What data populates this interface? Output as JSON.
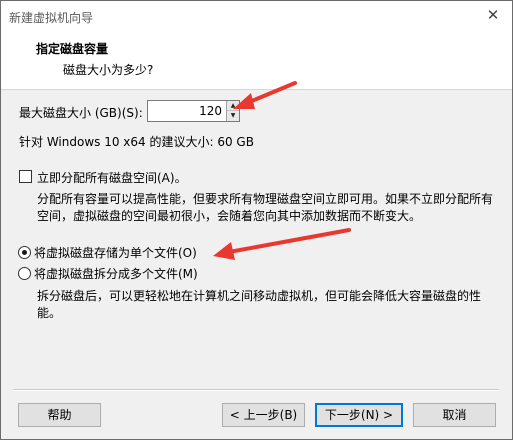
{
  "window": {
    "title": "新建虚拟机向导",
    "close_glyph": "✕"
  },
  "header": {
    "title": "指定磁盘容量",
    "subtitle": "磁盘大小为多少?"
  },
  "disk_size": {
    "label": "最大磁盘大小 (GB)(S):",
    "value": "120",
    "recommended": "针对 Windows 10 x64 的建议大小: 60 GB"
  },
  "allocate": {
    "label": "立即分配所有磁盘空间(A)。",
    "checked": false,
    "description": "分配所有容量可以提高性能，但要求所有物理磁盘空间立即可用。如果不立即分配所有空间，虚拟磁盘的空间最初很小，会随着您向其中添加数据而不断变大。"
  },
  "storage_options": [
    {
      "label": "将虚拟磁盘存储为单个文件(O)",
      "selected": true
    },
    {
      "label": "将虚拟磁盘拆分成多个文件(M)",
      "selected": false
    }
  ],
  "split_description": "拆分磁盘后，可以更轻松地在计算机之间移动虚拟机，但可能会降低大容量磁盘的性能。",
  "buttons": {
    "help": "帮助",
    "back": "< 上一步(B)",
    "next": "下一步(N) >",
    "cancel": "取消"
  },
  "colors": {
    "annotation_arrow": "#e8382f",
    "focus": "#0078d7"
  }
}
